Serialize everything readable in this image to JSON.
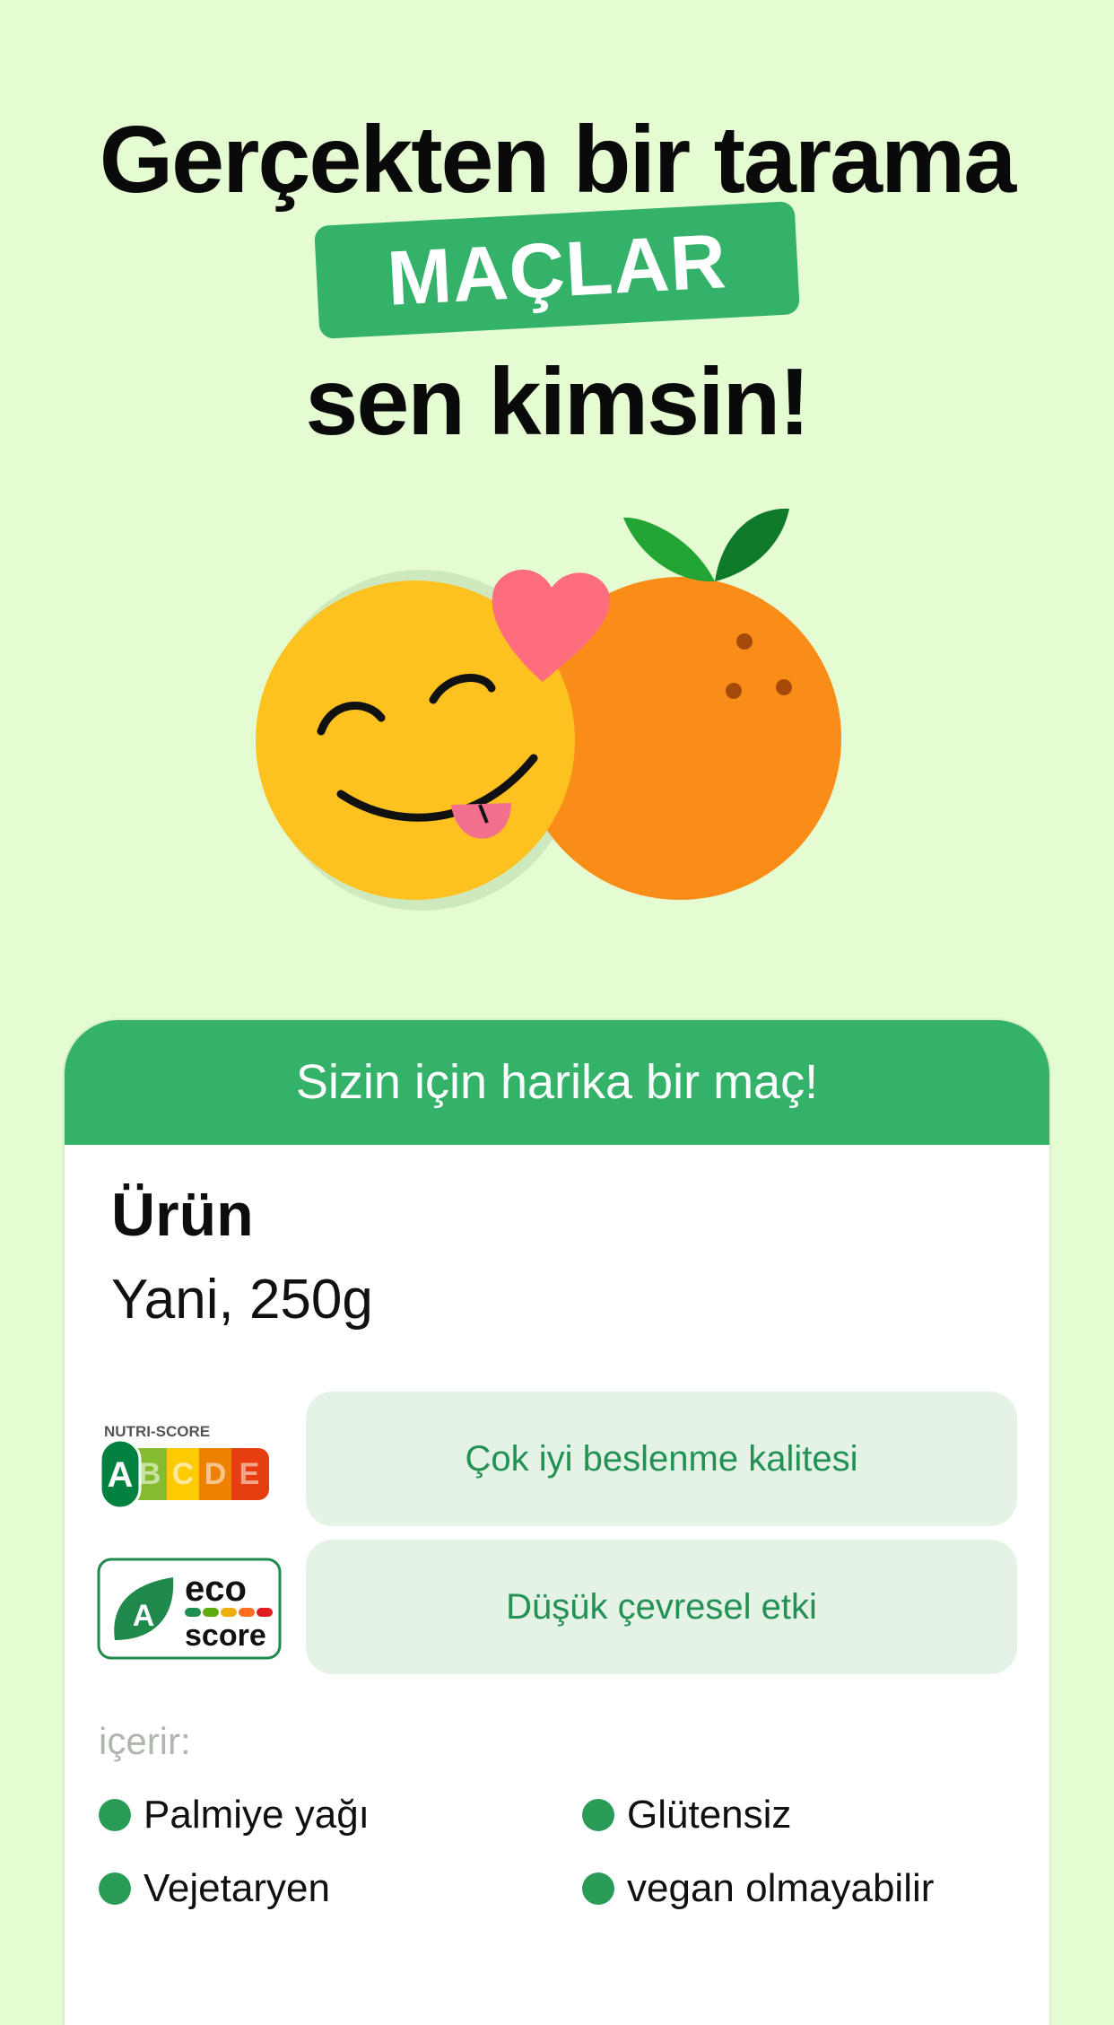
{
  "headline": {
    "line1": "Gerçekten bir tarama",
    "badge": "MAÇLAR",
    "line3": "sen kimsin!"
  },
  "card": {
    "header": "Sizin için harika bir maç!",
    "product_title": "Ürün",
    "product_subtitle": "Yani, 250g",
    "nutri_score": {
      "label": "NUTRI-SCORE",
      "grades": [
        "A",
        "B",
        "C",
        "D",
        "E"
      ],
      "selected": "A",
      "description": "Çok iyi beslenme kalitesi"
    },
    "eco_score": {
      "grade": "A",
      "word1": "eco",
      "word2": "score",
      "description": "Düşük çevresel etki"
    },
    "contains_label": "içerir:",
    "attributes": [
      "Palmiye yağı",
      "Glütensiz",
      "Vejetaryen",
      "vegan olmayabilir"
    ]
  },
  "colors": {
    "background": "#e5fbd2",
    "accent": "#34b26a",
    "pill": "#e5f3e7",
    "pill_text": "#239153"
  }
}
